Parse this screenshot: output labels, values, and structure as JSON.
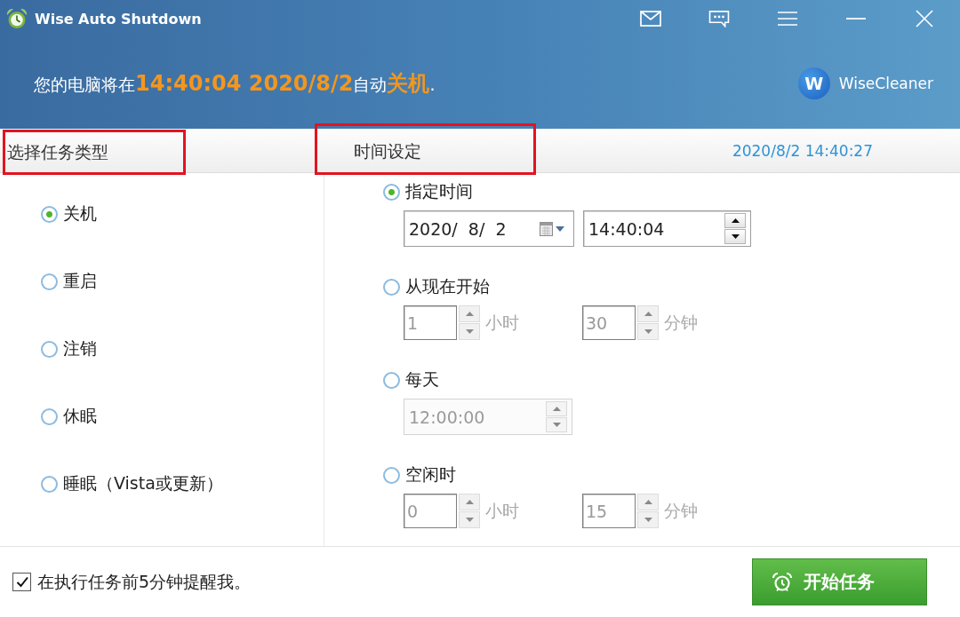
{
  "window": {
    "title": "Wise Auto Shutdown"
  },
  "banner": {
    "message": "您的电脑将在**14:40:04 2020/8/2**自动**关机**.",
    "brand_mark": "W",
    "brand": "WiseCleaner"
  },
  "task_type": {
    "title": "选择任务类型",
    "highlighted": true,
    "options": [
      {
        "label": "关机",
        "selected": true
      },
      {
        "label": "重启",
        "selected": false
      },
      {
        "label": "注销",
        "selected": false
      },
      {
        "label": "休眠",
        "selected": false
      },
      {
        "label": "睡眠（Vista或更新）",
        "selected": false
      }
    ]
  },
  "time_settings": {
    "title": "时间设定",
    "highlighted": true,
    "clock": "2020/8/2 14:40:27",
    "modes": [
      {
        "kind": "date_time",
        "label": "指定时间",
        "selected": true,
        "date": "2020/  8/  2",
        "time": "14:40:04"
      },
      {
        "kind": "duration",
        "label": "从现在开始",
        "selected": false,
        "hours": "1",
        "hours_unit": "小时",
        "minutes": "30",
        "minutes_unit": "分钟"
      },
      {
        "kind": "daily",
        "label": "每天",
        "selected": false,
        "time": "12:00:00"
      },
      {
        "kind": "duration",
        "label": "空闲时",
        "selected": false,
        "hours": "0",
        "hours_unit": "小时",
        "minutes": "15",
        "minutes_unit": "分钟"
      }
    ]
  },
  "footer": {
    "reminder": {
      "label": "在执行任务前5分钟提醒我。",
      "checked": true
    },
    "start_button": "开始任务"
  }
}
